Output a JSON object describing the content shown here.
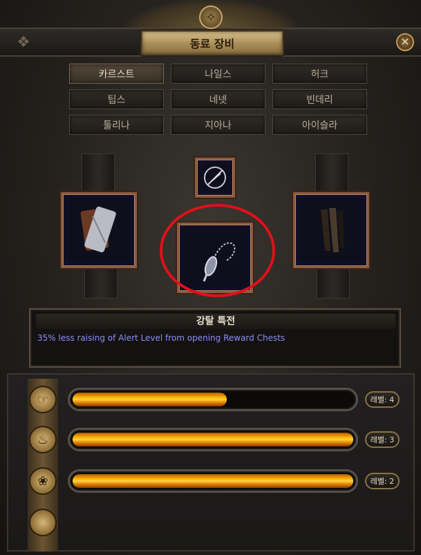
{
  "window": {
    "title": "동료 장비",
    "close_label": "✕"
  },
  "tabs": [
    {
      "label": "카르스트",
      "active": true
    },
    {
      "label": "나일스",
      "active": false
    },
    {
      "label": "허크",
      "active": false
    },
    {
      "label": "팁스",
      "active": false
    },
    {
      "label": "네넷",
      "active": false
    },
    {
      "label": "빈데리",
      "active": false
    },
    {
      "label": "툴리나",
      "active": false
    },
    {
      "label": "지아나",
      "active": false
    },
    {
      "label": "아이슬라",
      "active": false
    }
  ],
  "equipment": {
    "top_slot_icon": "feather-quill-icon",
    "left_slot_icon": "scroll-bundle-icon",
    "center_slot_icon": "vial-pendant-icon",
    "right_slot_icon": "leather-straps-icon",
    "highlight_color": "#e0101a"
  },
  "info": {
    "title": "강탈 특전",
    "description": "35% less raising of Alert Level from opening Reward Chests",
    "description_color": "#8e8cff"
  },
  "progress": [
    {
      "icon": "hand-coin-icon",
      "fill_fraction": 0.55,
      "level": "레벨: 4"
    },
    {
      "icon": "torch-icon",
      "fill_fraction": 1.0,
      "level": "레벨: 3"
    },
    {
      "icon": "tangled-rope-icon",
      "fill_fraction": 1.0,
      "level": "레벨: 2"
    }
  ],
  "empty_medal_icon": "blank-medal-icon",
  "colors": {
    "bar_fill": "#ffb500",
    "frame_accent": "#8a5a3e"
  }
}
